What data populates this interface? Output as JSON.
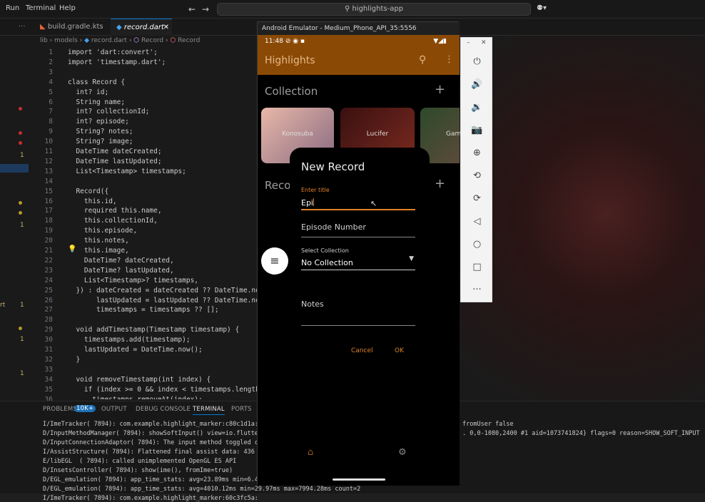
{
  "menubar": {
    "items": [
      "Run",
      "Terminal",
      "Help"
    ],
    "search": "highlights-app"
  },
  "tabs": [
    {
      "label": "build.gradle.kts",
      "active": false
    },
    {
      "label": "record.dart",
      "active": true
    }
  ],
  "breadcrumb": [
    "lib",
    "models",
    "record.dart",
    "Record",
    "Record"
  ],
  "code": {
    "lines": [
      1,
      2,
      3,
      4,
      5,
      6,
      7,
      8,
      9,
      10,
      11,
      12,
      13,
      14,
      15,
      16,
      17,
      18,
      19,
      20,
      21,
      22,
      23,
      24,
      25,
      26,
      27,
      28,
      29,
      30,
      31,
      32,
      33,
      34,
      35,
      36
    ],
    "text": [
      "import 'dart:convert';",
      "import 'timestamp.dart';",
      "",
      "class Record {",
      "  int? id;",
      "  String name;",
      "  int? collectionId;",
      "  int? episode;",
      "  String? notes;",
      "  String? image;",
      "  DateTime dateCreated;",
      "  DateTime lastUpdated;",
      "  List<Timestamp> timestamps;",
      "",
      "  Record({",
      "    this.id,",
      "    required this.name,",
      "    this.collectionId,",
      "    this.episode,",
      "    this.notes,",
      "    this.image,",
      "    DateTime? dateCreated,",
      "    DateTime? lastUpdated,",
      "    List<Timestamp>? timestamps,",
      "  }) : dateCreated = dateCreated ?? DateTime.now(),",
      "       lastUpdated = lastUpdated ?? DateTime.now(),",
      "       timestamps = timestamps ?? [];",
      "",
      "  void addTimestamp(Timestamp timestamp) {",
      "    timestamps.add(timestamp);",
      "    lastUpdated = DateTime.now();",
      "  }",
      "",
      "  void removeTimestamp(int index) {",
      "    if (index >= 0 && index < timestamps.length) {",
      "      timestamps.removeAt(index);"
    ],
    "gutter_numbers": [
      "1",
      "1",
      "1",
      "1",
      "1"
    ],
    "gutter_side_label": "rt"
  },
  "panel": {
    "tabs": [
      "PROBLEMS",
      "OUTPUT",
      "DEBUG CONSOLE",
      "TERMINAL",
      "PORTS"
    ],
    "problems_badge": "10K+",
    "terminal_lines": [
      "I/ImeTracker( 7894): com.example.highlight_marker:c80c1d1a:",
      "D/InputMethodManager( 7894): showSoftInput() view=io.flutte",
      "D/InputConnectionAdaptor( 7894): The input method toggled c",
      "I/AssistStructure( 7894): Flattened final assist data: 436",
      "E/libEGL  ( 7894): called unimplemented OpenGL ES API",
      "D/InsetsController( 7894): show(ime(), fromIme=true)",
      "D/EGL_emulation( 7894): app_time_stats: avg=23.89ms min=6.4",
      "D/EGL_emulation( 7894): app_time_stats: avg=4010.12ms min=29.97ms max=7994.28ms count=2",
      "I/ImeTracker( 7894): com.example.highlight_marker:60c3fc5a:"
    ],
    "right_lines": [
      "fromUser false",
      ". 0,0-1080,2400 #1 aid=1073741824} flags=0 reason=SHOW_SOFT_INPUT"
    ]
  },
  "emulator": {
    "title": "Android Emulator - Medium_Phone_API_35:5556",
    "status_time": "11:48",
    "app_title": "Highlights",
    "collection_header": "Collection",
    "records_header": "Reco",
    "cards": [
      "Konosuba",
      "Lucifer",
      "Gam"
    ],
    "dialog": {
      "title": "New Record",
      "title_field_label": "Enter title",
      "title_field_value": "Epi",
      "episode_placeholder": "Episode Number",
      "collection_label": "Select Collection",
      "collection_value": "No Collection",
      "notes_placeholder": "Notes",
      "cancel": "Cancel",
      "ok": "OK"
    },
    "accent": "#e0822a",
    "appbar_color": "#8a4a06"
  }
}
